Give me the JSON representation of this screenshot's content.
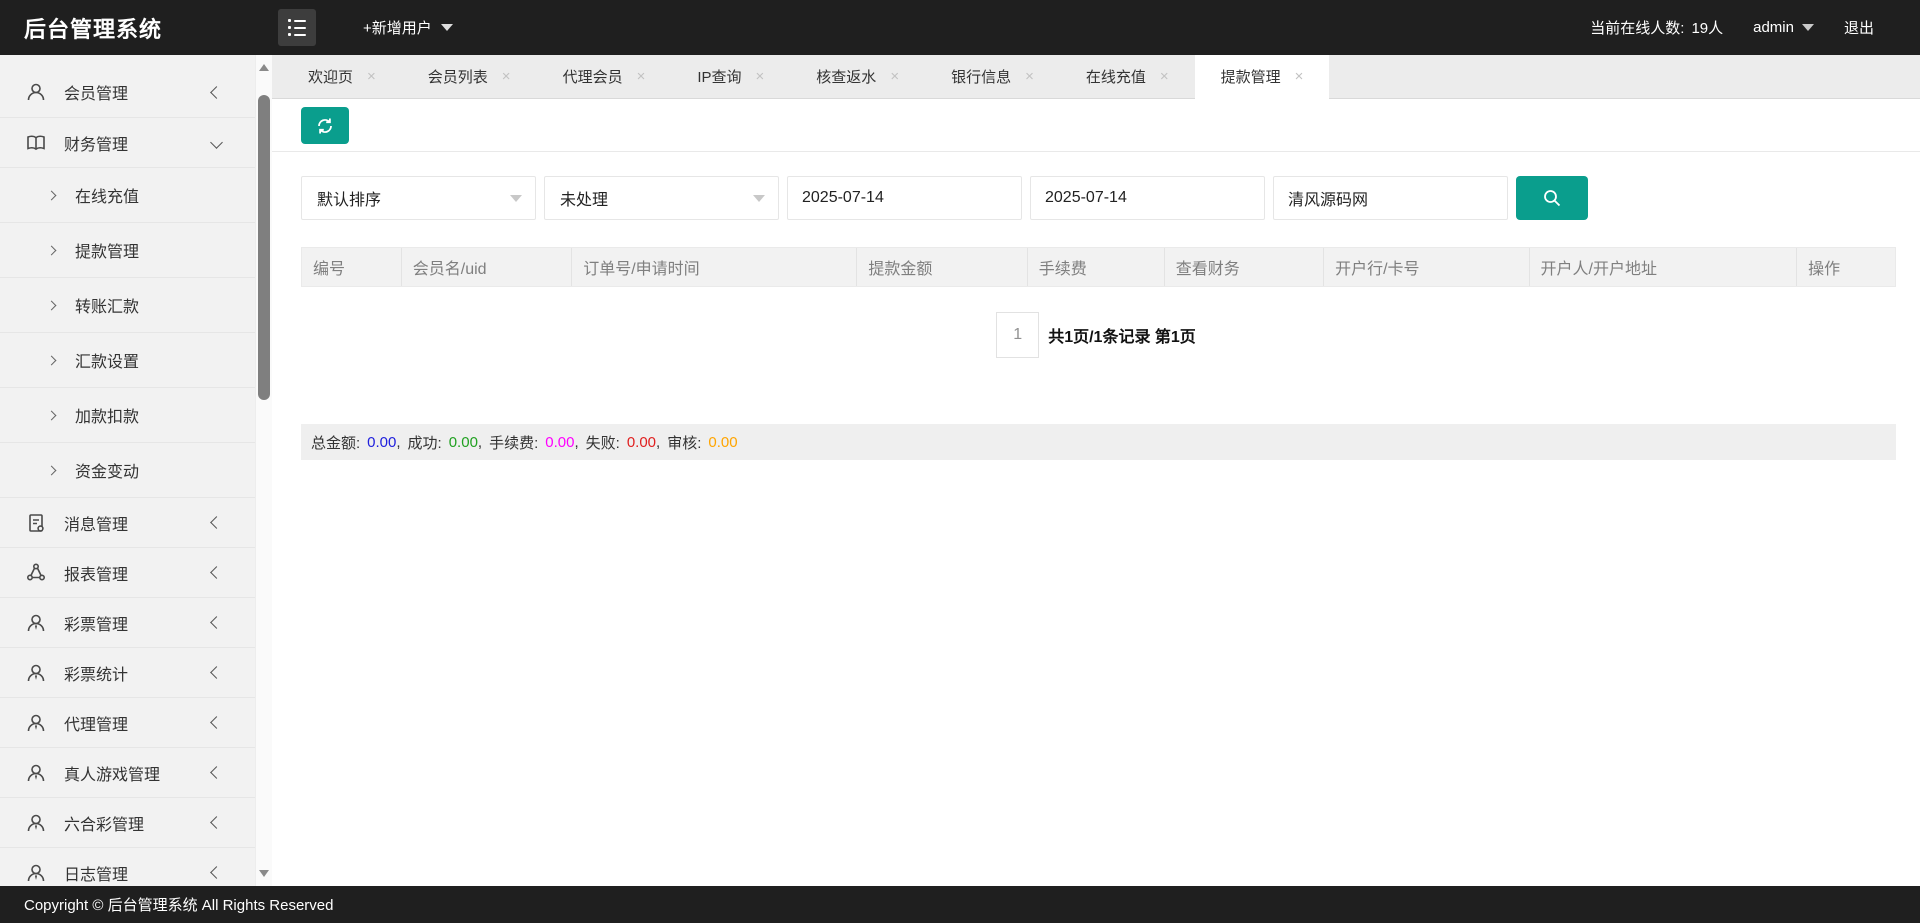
{
  "topbar": {
    "title": "后台管理系统",
    "add_user": "+新增用户",
    "online_label": "当前在线人数:",
    "online_count": "19人",
    "username": "admin",
    "logout": "退出"
  },
  "sidebar": {
    "items": [
      {
        "label": "会员管理",
        "icon": "user-icon"
      },
      {
        "label": "财务管理",
        "icon": "finance-book-icon",
        "expanded": true,
        "children": [
          {
            "label": "在线充值"
          },
          {
            "label": "提款管理"
          },
          {
            "label": "转账汇款"
          },
          {
            "label": "汇款设置"
          },
          {
            "label": "加款扣款"
          },
          {
            "label": "资金变动"
          }
        ]
      },
      {
        "label": "消息管理",
        "icon": "message-doc-icon"
      },
      {
        "label": "报表管理",
        "icon": "report-share-icon"
      },
      {
        "label": "彩票管理",
        "icon": "user-tie-icon"
      },
      {
        "label": "彩票统计",
        "icon": "user-tie-icon"
      },
      {
        "label": "代理管理",
        "icon": "user-tie-icon"
      },
      {
        "label": "真人游戏管理",
        "icon": "user-tie-icon"
      },
      {
        "label": "六合彩管理",
        "icon": "user-tie-icon"
      },
      {
        "label": "日志管理",
        "icon": "user-tie-icon"
      }
    ]
  },
  "tabs": {
    "items": [
      {
        "label": "欢迎页"
      },
      {
        "label": "会员列表"
      },
      {
        "label": "代理会员"
      },
      {
        "label": "IP查询"
      },
      {
        "label": "核查返水"
      },
      {
        "label": "银行信息"
      },
      {
        "label": "在线充值"
      },
      {
        "label": "提款管理"
      }
    ],
    "active": "提款管理"
  },
  "filters": {
    "sort": "默认排序",
    "status": "未处理",
    "date_from": "2025-07-14",
    "date_to": "2025-07-14",
    "keyword": "清风源码网"
  },
  "table": {
    "columns": [
      "编号",
      "会员名/uid",
      "订单号/申请时间",
      "提款金额",
      "手续费",
      "查看财务",
      "开户行/卡号",
      "开户人/开户地址",
      "操作"
    ],
    "rows": []
  },
  "pagination": {
    "page": "1",
    "info": "共1页/1条记录 第1页"
  },
  "summary": {
    "segments": [
      {
        "label": "总金额:",
        "value": "0.00",
        "color": "#2020dd",
        "sep": ","
      },
      {
        "label": "成功:",
        "value": "0.00",
        "color": "#21a121",
        "sep": ","
      },
      {
        "label": "手续费:",
        "value": "0.00",
        "color": "#ff00ff",
        "sep": ","
      },
      {
        "label": "失败:",
        "value": "0.00",
        "color": "#e02020",
        "sep": ","
      },
      {
        "label": "审核:",
        "value": "0.00",
        "color": "#ffa500",
        "sep": ""
      }
    ]
  },
  "footer": {
    "text": "Copyright © 后台管理系统 All Rights Reserved"
  },
  "colors": {
    "accent": "#0a9e8d",
    "topbar_bg": "#1f1f1f",
    "sidebar_bg": "#f2f2f2",
    "summary_bg": "#efefef"
  }
}
